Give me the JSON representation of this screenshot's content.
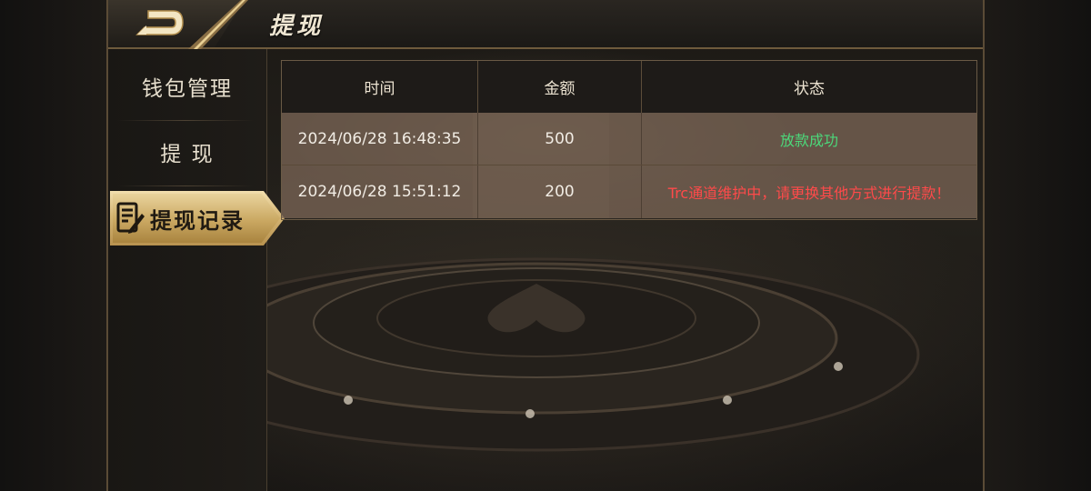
{
  "header": {
    "title": "提现"
  },
  "sidebar": {
    "items": [
      {
        "label": "钱包管理"
      },
      {
        "label": "提 现"
      },
      {
        "label": "提现记录"
      }
    ]
  },
  "table": {
    "headers": [
      "时间",
      "金额",
      "状态"
    ],
    "rows": [
      {
        "time": "2024/06/28 16:48:35",
        "amount": "500",
        "status": "放款成功",
        "status_color": "#4cd87a"
      },
      {
        "time": "2024/06/28 15:51:12",
        "amount": "200",
        "status": "Trc通道维护中，请更换其他方式进行提款！",
        "status_color": "#ff4a4a"
      }
    ]
  },
  "colors": {
    "gold": "#d6b776",
    "frame": "#6e5a3c",
    "success": "#4cd87a",
    "error": "#ff4a4a"
  },
  "icons": {
    "back": "back-arrow-icon",
    "record": "edit-record-icon"
  }
}
